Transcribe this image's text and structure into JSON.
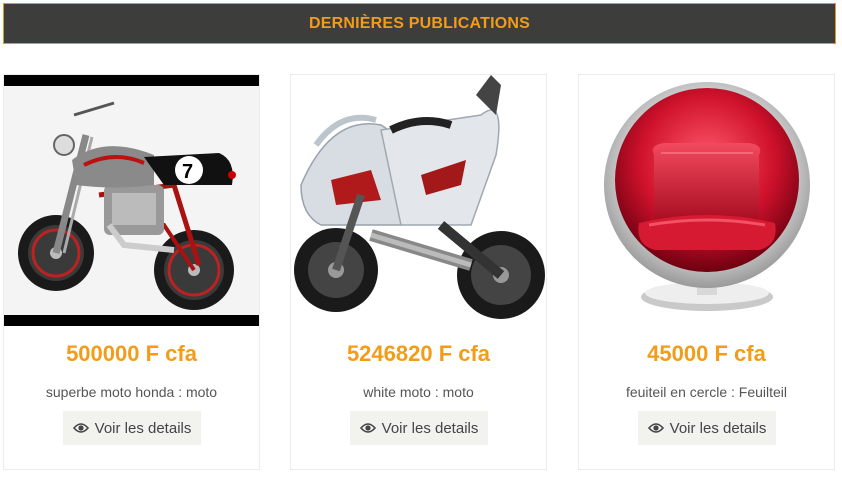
{
  "section": {
    "title": "DERNIÈRES PUBLICATIONS"
  },
  "colors": {
    "accent": "#f39c1a",
    "header_bg": "#3d3d3b",
    "button_bg": "#f2f2ef"
  },
  "listings": [
    {
      "image_icon": "motorcycle-cafe-racer-image",
      "price": "500000 F cfa",
      "description": "superbe moto honda : moto",
      "button_label": "Voir les details",
      "button_icon": "eye-icon"
    },
    {
      "image_icon": "motorcycle-sport-image",
      "price": "5246820 F cfa",
      "description": "white moto : moto",
      "button_label": "Voir les details",
      "button_icon": "eye-icon"
    },
    {
      "image_icon": "egg-chair-image",
      "price": "45000 F cfa",
      "description": "feuiteil en cercle : Feuilteil",
      "button_label": "Voir les details",
      "button_icon": "eye-icon"
    }
  ]
}
